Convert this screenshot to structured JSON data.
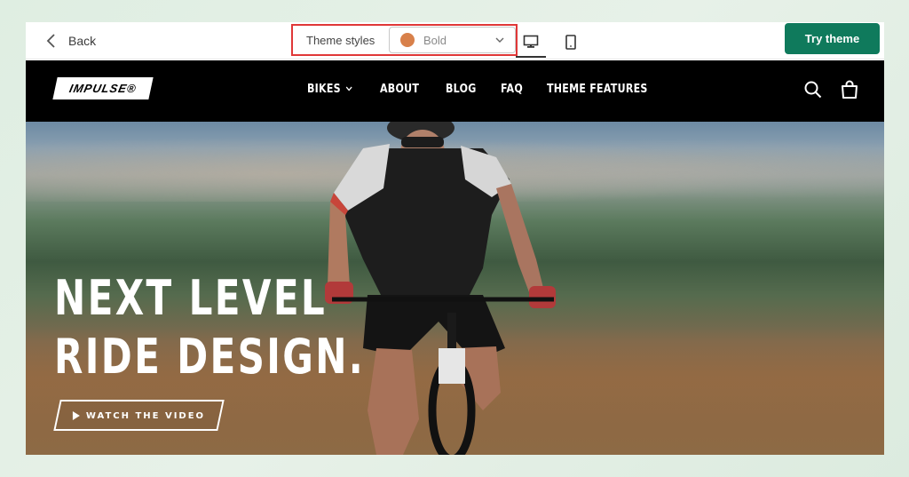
{
  "editor": {
    "back_label": "Back",
    "theme_styles_label": "Theme styles",
    "theme_style_value": "Bold",
    "theme_style_color": "#d8804a",
    "try_label": "Try theme",
    "try_color": "#0f7a5c",
    "highlight_color": "#e03838"
  },
  "store": {
    "logo_text": "IMPULSE®",
    "nav": [
      "BIKES",
      "ABOUT",
      "BLOG",
      "FAQ",
      "THEME FEATURES"
    ],
    "icons": [
      "search-icon",
      "cart-icon"
    ]
  },
  "hero": {
    "title_line1": "NEXT LEVEL",
    "title_line2": "RIDE DESIGN.",
    "cta_label": "WATCH THE VIDEO"
  }
}
